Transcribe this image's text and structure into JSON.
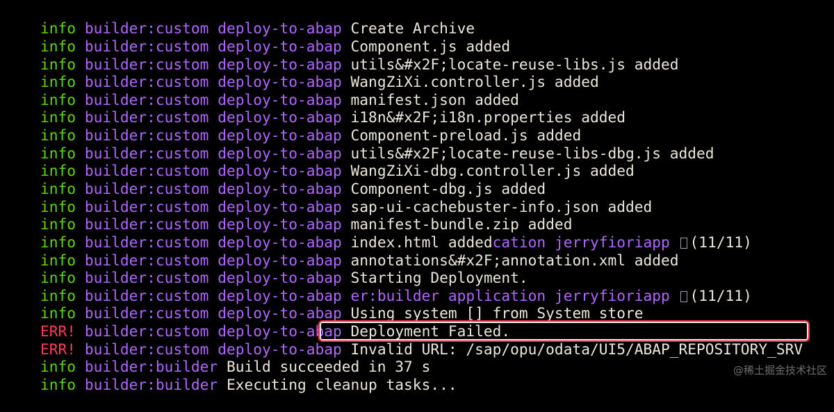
{
  "terminal": {
    "lines": [
      {
        "level": "info",
        "source": "builder:custom",
        "task": "deploy-to-abap",
        "message": "Create Archive"
      },
      {
        "level": "info",
        "source": "builder:custom",
        "task": "deploy-to-abap",
        "message": "Component.js added"
      },
      {
        "level": "info",
        "source": "builder:custom",
        "task": "deploy-to-abap",
        "message": "utils&#x2F;locate-reuse-libs.js added"
      },
      {
        "level": "info",
        "source": "builder:custom",
        "task": "deploy-to-abap",
        "message": "WangZiXi.controller.js added"
      },
      {
        "level": "info",
        "source": "builder:custom",
        "task": "deploy-to-abap",
        "message": "manifest.json added"
      },
      {
        "level": "info",
        "source": "builder:custom",
        "task": "deploy-to-abap",
        "message": "i18n&#x2F;i18n.properties added"
      },
      {
        "level": "info",
        "source": "builder:custom",
        "task": "deploy-to-abap",
        "message": "Component-preload.js added"
      },
      {
        "level": "info",
        "source": "builder:custom",
        "task": "deploy-to-abap",
        "message": "utils&#x2F;locate-reuse-libs-dbg.js added"
      },
      {
        "level": "info",
        "source": "builder:custom",
        "task": "deploy-to-abap",
        "message": "WangZiXi-dbg.controller.js added"
      },
      {
        "level": "info",
        "source": "builder:custom",
        "task": "deploy-to-abap",
        "message": "Component-dbg.js added"
      },
      {
        "level": "info",
        "source": "builder:custom",
        "task": "deploy-to-abap",
        "message": "sap-ui-cachebuster-info.json added"
      },
      {
        "level": "info",
        "source": "builder:custom",
        "task": "deploy-to-abap",
        "message": "manifest-bundle.zip added"
      },
      {
        "level": "info",
        "source": "builder:custom",
        "task": "deploy-to-abap",
        "message": "index.html added",
        "overlay": "cation jerryfioriapp",
        "tail": "(11/11)"
      },
      {
        "level": "info",
        "source": "builder:custom",
        "task": "deploy-to-abap",
        "message": "annotations&#x2F;annotation.xml added"
      },
      {
        "level": "info",
        "source": "builder:custom",
        "task": "deploy-to-abap",
        "message": "Starting Deployment."
      },
      {
        "level": "info",
        "source": "builder:custom",
        "task": "deploy-to-abap",
        "message": "",
        "overlay": "er:builder application jerryfioriapp",
        "tail": "(11/11)"
      },
      {
        "level": "info",
        "source": "builder:custom",
        "task": "deploy-to-abap",
        "message": "Using system [] from System store"
      },
      {
        "level": "ERR!",
        "source": "builder:custom",
        "task": "deploy-to-abap",
        "message": "Deployment Failed."
      },
      {
        "level": "ERR!",
        "source": "builder:custom",
        "task": "deploy-to-abap",
        "message": "Invalid URL: /sap/opu/odata/UI5/ABAP_REPOSITORY_SRV"
      },
      {
        "level": "info",
        "source": "builder:builder",
        "task": "",
        "message": "Build succeeded in 37 s"
      },
      {
        "level": "info",
        "source": "builder:builder",
        "task": "",
        "message": "Executing cleanup tasks..."
      }
    ]
  },
  "watermark": "@稀土掘金技术社区",
  "colors": {
    "background": "#000000",
    "info": "#5fd700",
    "error": "#ff3b5c",
    "source": "#b066ff",
    "message": "#ece7da",
    "highlight": "#ff2d3d"
  }
}
